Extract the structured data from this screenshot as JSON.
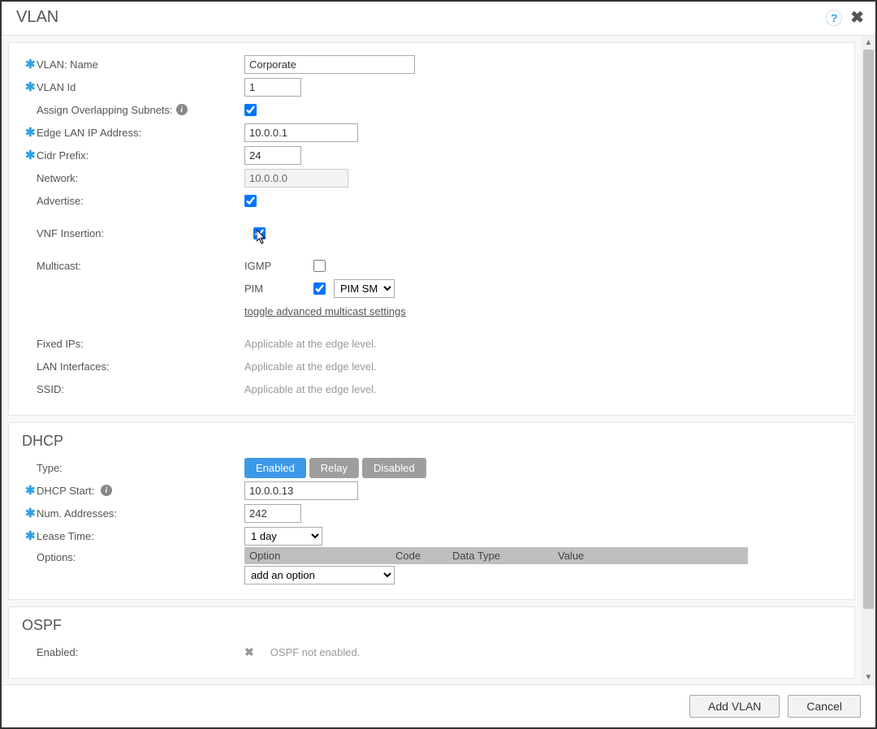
{
  "header": {
    "title": "VLAN"
  },
  "vlan": {
    "name_label": "VLAN: Name",
    "name_value": "Corporate",
    "id_label": "VLAN Id",
    "id_value": "1",
    "overlap_label": "Assign Overlapping Subnets:",
    "overlap_checked": true,
    "edge_ip_label": "Edge LAN IP Address:",
    "edge_ip_value": "10.0.0.1",
    "cidr_label": "Cidr Prefix:",
    "cidr_value": "24",
    "network_label": "Network:",
    "network_value": "10.0.0.0",
    "advertise_label": "Advertise:",
    "advertise_checked": true,
    "vnf_label": "VNF Insertion:",
    "vnf_checked": true,
    "multicast_label": "Multicast:",
    "igmp_label": "IGMP",
    "igmp_checked": false,
    "pim_label": "PIM",
    "pim_checked": true,
    "pim_mode": "PIM SM",
    "toggle_multicast": "toggle advanced multicast settings",
    "fixed_ips_label": "Fixed IPs:",
    "lan_if_label": "LAN Interfaces:",
    "ssid_label": "SSID:",
    "edge_applicable": "Applicable at the edge level."
  },
  "dhcp": {
    "title": "DHCP",
    "type_label": "Type:",
    "btn_enabled": "Enabled",
    "btn_relay": "Relay",
    "btn_disabled": "Disabled",
    "start_label": "DHCP Start:",
    "start_value": "10.0.0.13",
    "num_label": "Num. Addresses:",
    "num_value": "242",
    "lease_label": "Lease Time:",
    "lease_value": "1 day",
    "options_label": "Options:",
    "col_option": "Option",
    "col_code": "Code",
    "col_datatype": "Data Type",
    "col_value": "Value",
    "add_option": "add an option"
  },
  "ospf": {
    "title": "OSPF",
    "enabled_label": "Enabled:",
    "not_enabled": "OSPF not enabled."
  },
  "footer": {
    "add": "Add VLAN",
    "cancel": "Cancel"
  }
}
